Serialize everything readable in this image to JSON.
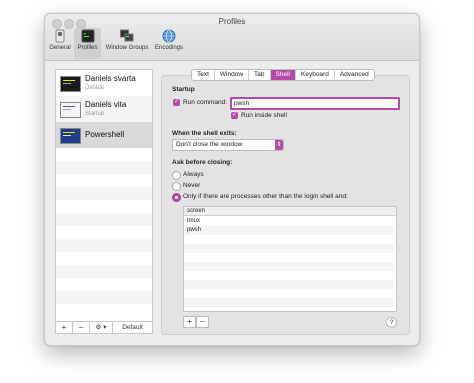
{
  "window": {
    "title": "Profiles"
  },
  "toolbar": {
    "items": [
      {
        "label": "General",
        "icon": "switch-icon"
      },
      {
        "label": "Profiles",
        "icon": "terminal-icon"
      },
      {
        "label": "Window Groups",
        "icon": "window-groups-icon"
      },
      {
        "label": "Encodings",
        "icon": "globe-icon"
      }
    ],
    "selected": "Profiles"
  },
  "profiles": {
    "items": [
      {
        "name": "Daniels svarta",
        "subtitle": "Default"
      },
      {
        "name": "Daniels vita",
        "subtitle": "Startup"
      },
      {
        "name": "Powershell",
        "subtitle": ""
      }
    ],
    "selected": "Powershell",
    "buttons": {
      "add": "+",
      "remove": "−",
      "actions": "⚙︎ ▾",
      "default": "Default"
    }
  },
  "tabs": {
    "items": [
      "Text",
      "Window",
      "Tab",
      "Shell",
      "Keyboard",
      "Advanced"
    ],
    "selected": "Shell"
  },
  "shell": {
    "startup_heading": "Startup",
    "run_command_label": "Run command:",
    "run_command_checked": true,
    "run_command_value": "pwsh",
    "run_inside_shell_label": "Run inside shell",
    "run_inside_shell_checked": true,
    "exit_heading": "When the shell exits:",
    "exit_option": "Don't close the window",
    "ask_heading": "Ask before closing:",
    "ask_options": [
      {
        "label": "Always",
        "selected": false
      },
      {
        "label": "Never",
        "selected": false
      },
      {
        "label": "Only if there are processes other than the login shell and:",
        "selected": true
      }
    ],
    "process_table": {
      "header": "screen",
      "rows": [
        "tmux",
        "pwsh"
      ]
    },
    "add_button": "+",
    "remove_button": "−",
    "help_button": "?"
  },
  "colors": {
    "accent": "#b54aa8",
    "window_bg": "#ececec",
    "panel_bg": "#e3e3e3"
  }
}
